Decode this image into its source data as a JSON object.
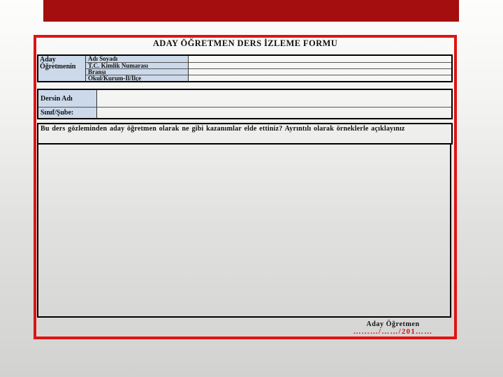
{
  "slide": {
    "banner_color": "#a50e0e",
    "frame_border_color": "#de1413",
    "label_cell_color": "#ccd9ea",
    "date_text_color": "#cc1212"
  },
  "form": {
    "title": "ADAY ÖĞRETMEN DERS İZLEME FORMU",
    "teacher_table": {
      "row_header": "Aday Öğretmenin",
      "rows": [
        {
          "label": "Adı Soyadı",
          "value": ""
        },
        {
          "label": "T.C. Kimlik Numarası",
          "value": ""
        },
        {
          "label": "Branşı",
          "value": ""
        },
        {
          "label": "Okul/Kurum-İl/İlçe",
          "value": ""
        }
      ]
    },
    "lesson_table": {
      "rows": [
        {
          "label": "Dersin Adı",
          "value": ""
        },
        {
          "label": "Sınıf/Şube:",
          "value": ""
        }
      ]
    },
    "question": "Bu ders gözleminden aday öğretmen olarak ne gibi kazanımlar elde ettiniz? Ayrıntılı olarak örneklerle açıklayınız",
    "answer_value": "",
    "footer": {
      "signature_label": "Aday Öğretmen",
      "date_placeholder": "…...…/……/201……"
    }
  }
}
